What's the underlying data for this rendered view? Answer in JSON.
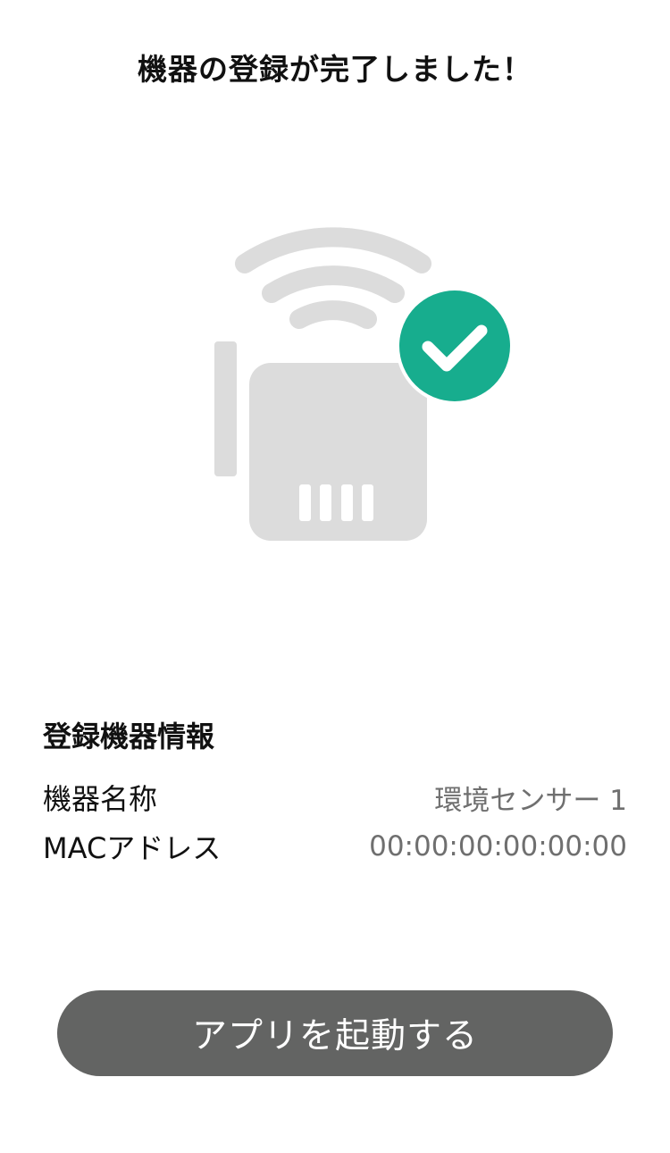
{
  "header": {
    "title": "機器の登録が完了しました！"
  },
  "illustration": {
    "icon": "router-registered-icon",
    "colors": {
      "device": "#dcdcdc",
      "badge": "#17ad8e",
      "check": "#ffffff"
    }
  },
  "info": {
    "heading": "登録機器情報",
    "rows": [
      {
        "label": "機器名称",
        "value": "環境センサー 1"
      },
      {
        "label": "MACアドレス",
        "value": "00:00:00:00:00:00"
      }
    ]
  },
  "footer": {
    "launch_label": "アプリを起動する",
    "button_color": "#636463"
  }
}
